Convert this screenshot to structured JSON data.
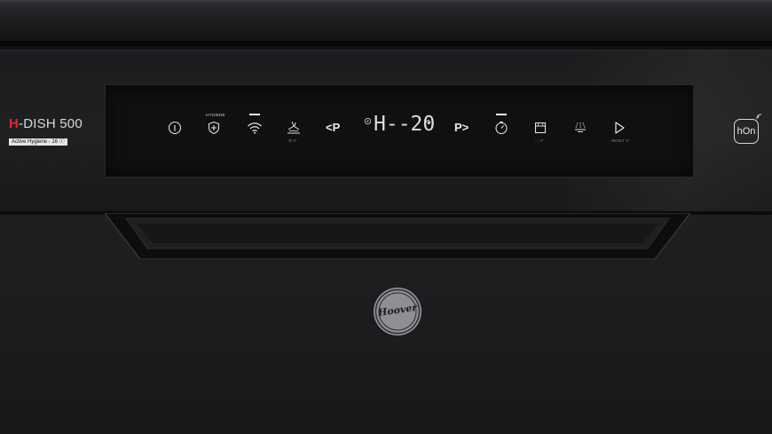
{
  "brand": {
    "prefix": "H",
    "model": "-DISH 500",
    "subtitle": "Active Hygiene - 16 ⓘ"
  },
  "panel": {
    "hygiene_label": "HYGIENE",
    "program_prev": "<P",
    "program_next": "P>",
    "display_text": "H--20",
    "under_rinse": "⚙ 3\"",
    "under_half": "⬚ 3\"",
    "under_start": "RESET 3\""
  },
  "connect": {
    "hon_label": "hOn"
  },
  "logo": {
    "text": "Hoover"
  },
  "colors": {
    "accent": "#e1262d",
    "panel_light": "#e0e0e0"
  }
}
